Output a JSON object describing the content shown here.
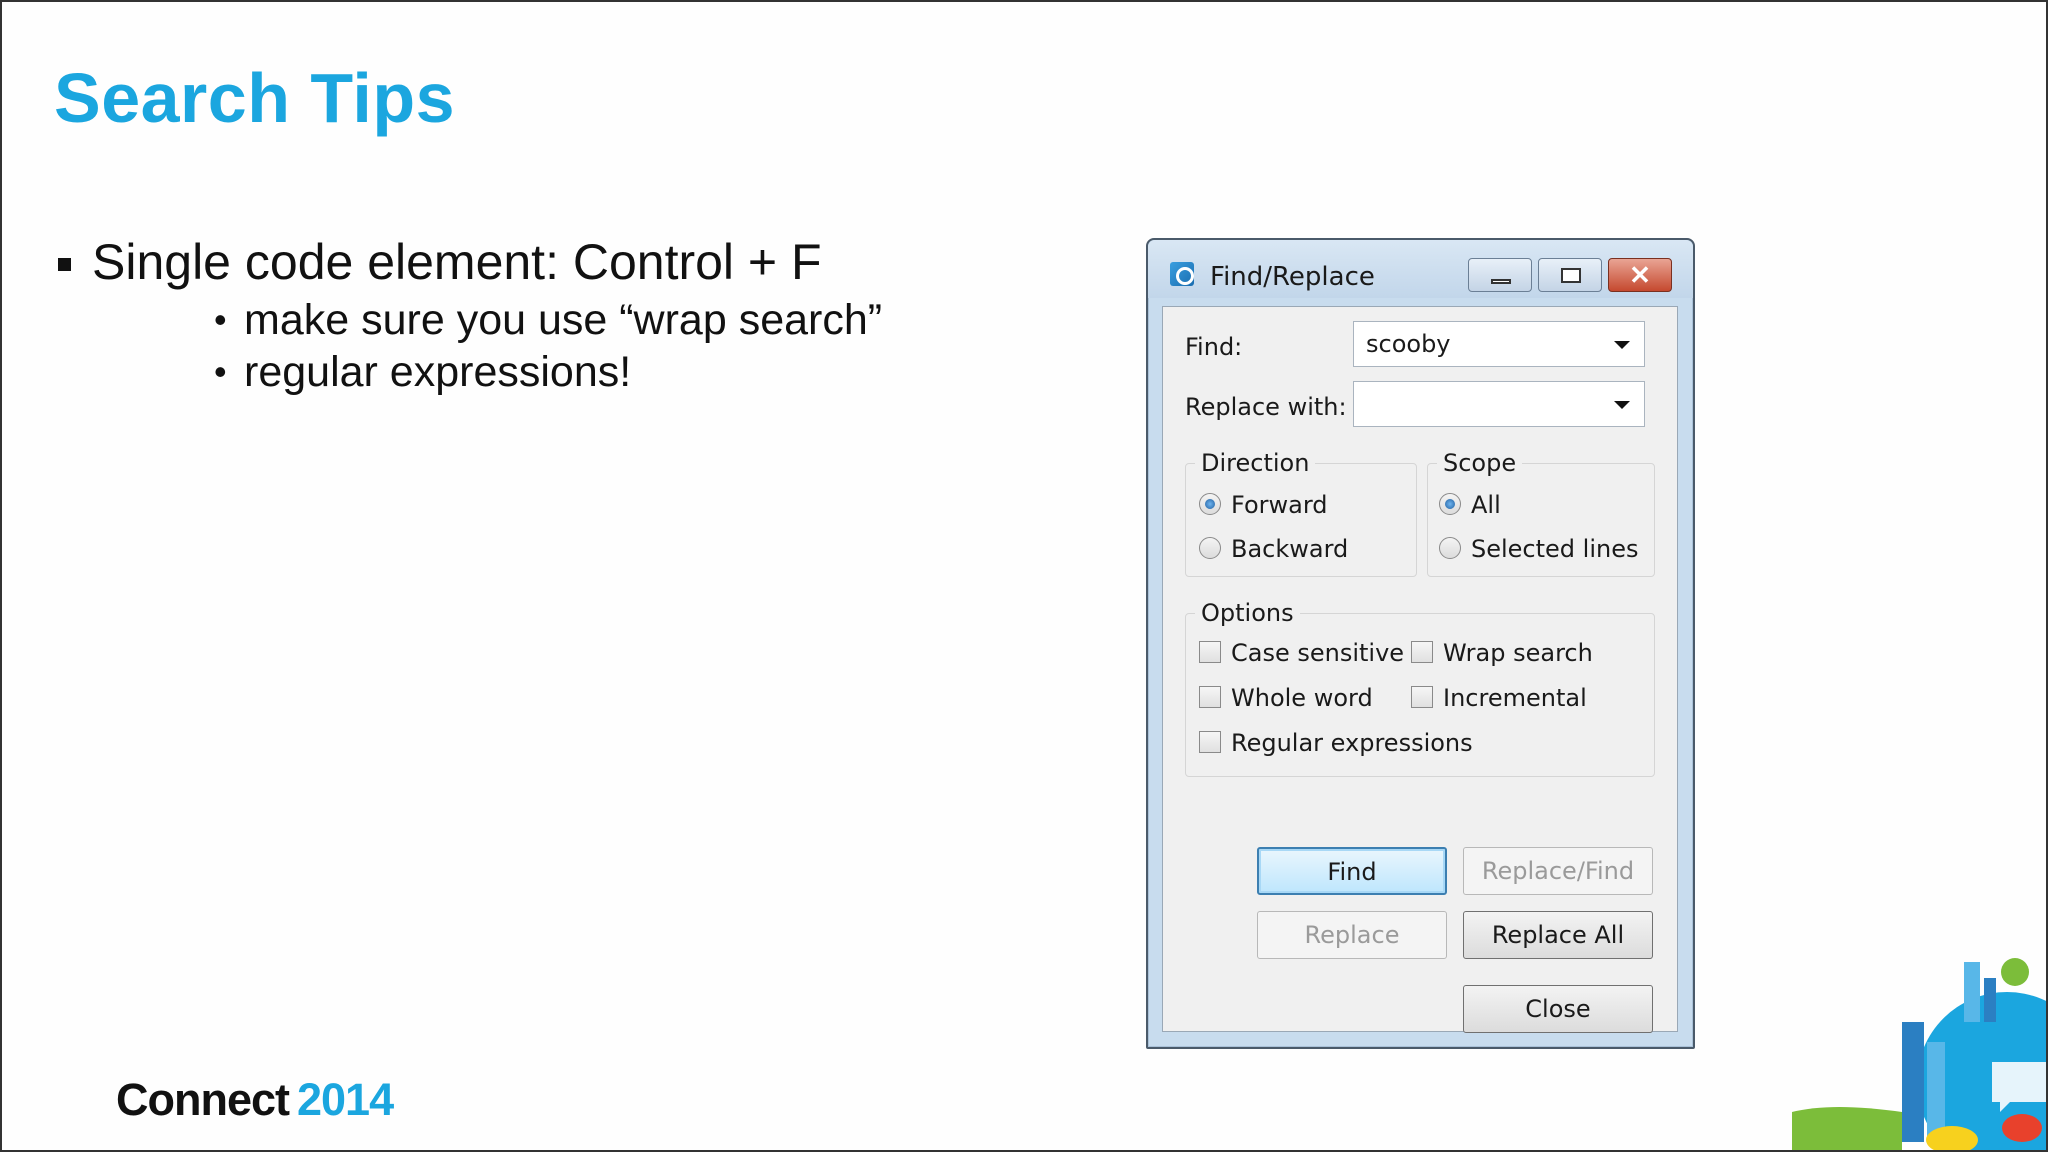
{
  "slide": {
    "title": "Search Tips",
    "bullets": {
      "main": "Single code element:  Control + F",
      "sub1": "make sure you use “wrap search”",
      "sub2": "regular expressions!"
    },
    "logo": {
      "word": "Connect",
      "year": "2014"
    }
  },
  "dialog": {
    "title": "Find/Replace",
    "find_label": "Find:",
    "find_value": "scooby",
    "replace_label": "Replace with:",
    "replace_value": "",
    "direction": {
      "title": "Direction",
      "forward": "Forward",
      "backward": "Backward",
      "selected": "Forward"
    },
    "scope": {
      "title": "Scope",
      "all": "All",
      "selected_lines": "Selected lines",
      "selected": "All"
    },
    "options": {
      "title": "Options",
      "case_sensitive": "Case sensitive",
      "wrap_search": "Wrap search",
      "whole_word": "Whole word",
      "incremental": "Incremental",
      "regex": "Regular expressions"
    },
    "buttons": {
      "find": "Find",
      "replace_find": "Replace/Find",
      "replace": "Replace",
      "replace_all": "Replace All",
      "close": "Close"
    }
  },
  "colors": {
    "accent": "#1ba6df",
    "title_bar": "#c8dcee",
    "close_button": "#c5492f"
  }
}
